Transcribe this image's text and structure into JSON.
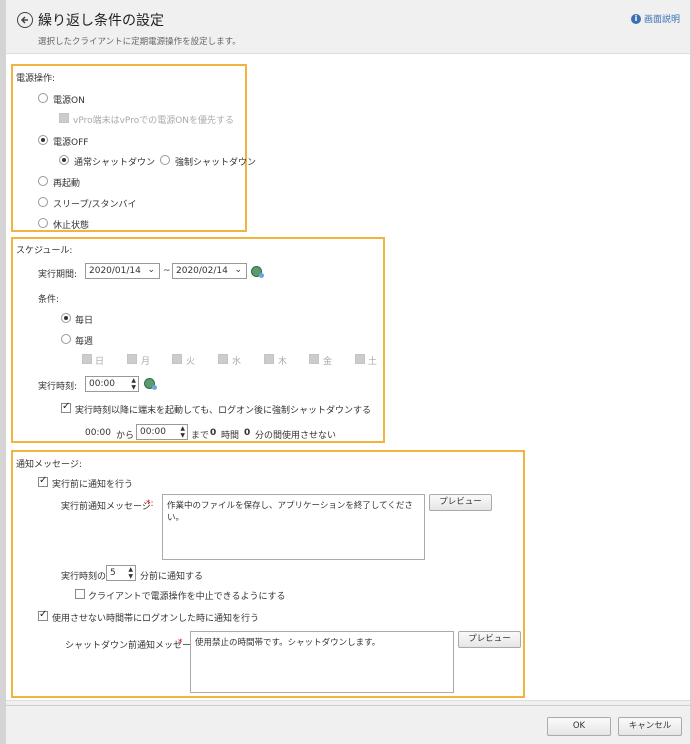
{
  "header": {
    "title": "繰り返し条件の設定",
    "subtitle": "選択したクライアントに定期電源操作を設定します。",
    "help_label": "画面説明"
  },
  "power": {
    "label": "電源操作:",
    "on_label": "電源ON",
    "vpro_label": "vPro端末はvProでの電源ONを優先する",
    "off_label": "電源OFF",
    "normal_shutdown": "通常シャットダウン",
    "force_shutdown": "強制シャットダウン",
    "restart": "再起動",
    "sleep": "スリープ/スタンバイ",
    "hibernate": "休止状態",
    "selected": "電源OFF"
  },
  "schedule": {
    "label": "スケジュール:",
    "period_label": "実行期間:",
    "start_date": "2020/01/14",
    "tilde": "~",
    "end_date": "2020/02/14",
    "condition_label": "条件:",
    "daily": "毎日",
    "weekly": "毎週",
    "days": [
      "日",
      "月",
      "火",
      "水",
      "木",
      "金",
      "土"
    ],
    "time_label": "実行時刻:",
    "time_value": "00:00",
    "shutdown_check": "実行時刻以降に端末を起動しても、ログオン後に強制シャットダウンする",
    "from_time": "00:00",
    "kara": "から",
    "to_time": "00:00",
    "made": "まで",
    "hours": "0",
    "hours_unit": "時間",
    "minutes": "0",
    "minutes_unit": "分の間使用させない"
  },
  "notify": {
    "label": "通知メッセージ:",
    "before_check": "実行前に通知を行う",
    "before_msg_label": "実行前通知メッセージ",
    "required": "*:",
    "before_msg": "作業中のファイルを保存し、アプリケーションを終了してください。",
    "preview": "プレビュー",
    "time_prefix": "実行時刻の",
    "minutes_value": "5",
    "time_suffix": "分前に通知する",
    "client_cancel": "クライアントで電源操作を中止できるようにする",
    "logon_check": "使用させない時間帯にログオンした時に通知を行う",
    "shutdown_msg_label": "シャットダウン前通知メッセージ",
    "required2": "*",
    "shutdown_msg": "使用禁止の時間帯です。シャットダウンします。",
    "preview2": "プレビュー"
  },
  "footer": {
    "ok": "OK",
    "cancel": "キャンセル"
  },
  "colors": {
    "highlight_border": "#f2b43e",
    "help_link": "#3a6fb5"
  }
}
